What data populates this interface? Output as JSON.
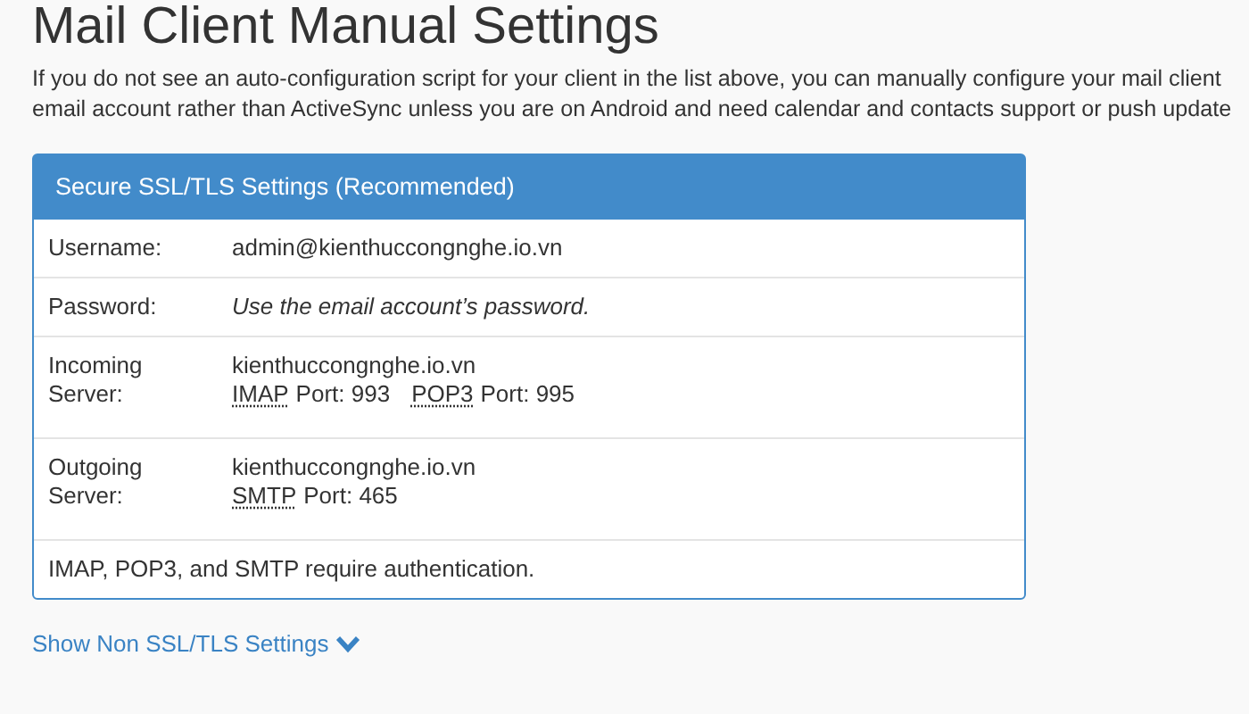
{
  "title": "Mail Client Manual Settings",
  "description": "If you do not see an auto-configuration script for your client in the list above, you can manually configure your mail client\nemail account rather than ActiveSync unless you are on Android and need calendar and contacts support or push update",
  "panel": {
    "header": "Secure SSL/TLS Settings (Recommended)",
    "rows": [
      {
        "kind": "text",
        "label": "Username:",
        "value": "admin@kienthuccongnghe.io.vn"
      },
      {
        "kind": "note",
        "label": "Password:",
        "value": "Use the email account’s password."
      },
      {
        "kind": "server",
        "label": "Incoming Server:",
        "host": "kienthuccongnghe.io.vn",
        "ports": [
          {
            "protocol": "IMAP",
            "port": "Port: 993"
          },
          {
            "protocol": "POP3",
            "port": "Port: 995"
          }
        ]
      },
      {
        "kind": "server",
        "label": "Outgoing Server:",
        "host": "kienthuccongnghe.io.vn",
        "ports": [
          {
            "protocol": "SMTP",
            "port": "Port: 465"
          }
        ]
      }
    ],
    "footer": "IMAP, POP3, and SMTP require authentication."
  },
  "toggle_link": "Show Non SSL/TLS Settings"
}
